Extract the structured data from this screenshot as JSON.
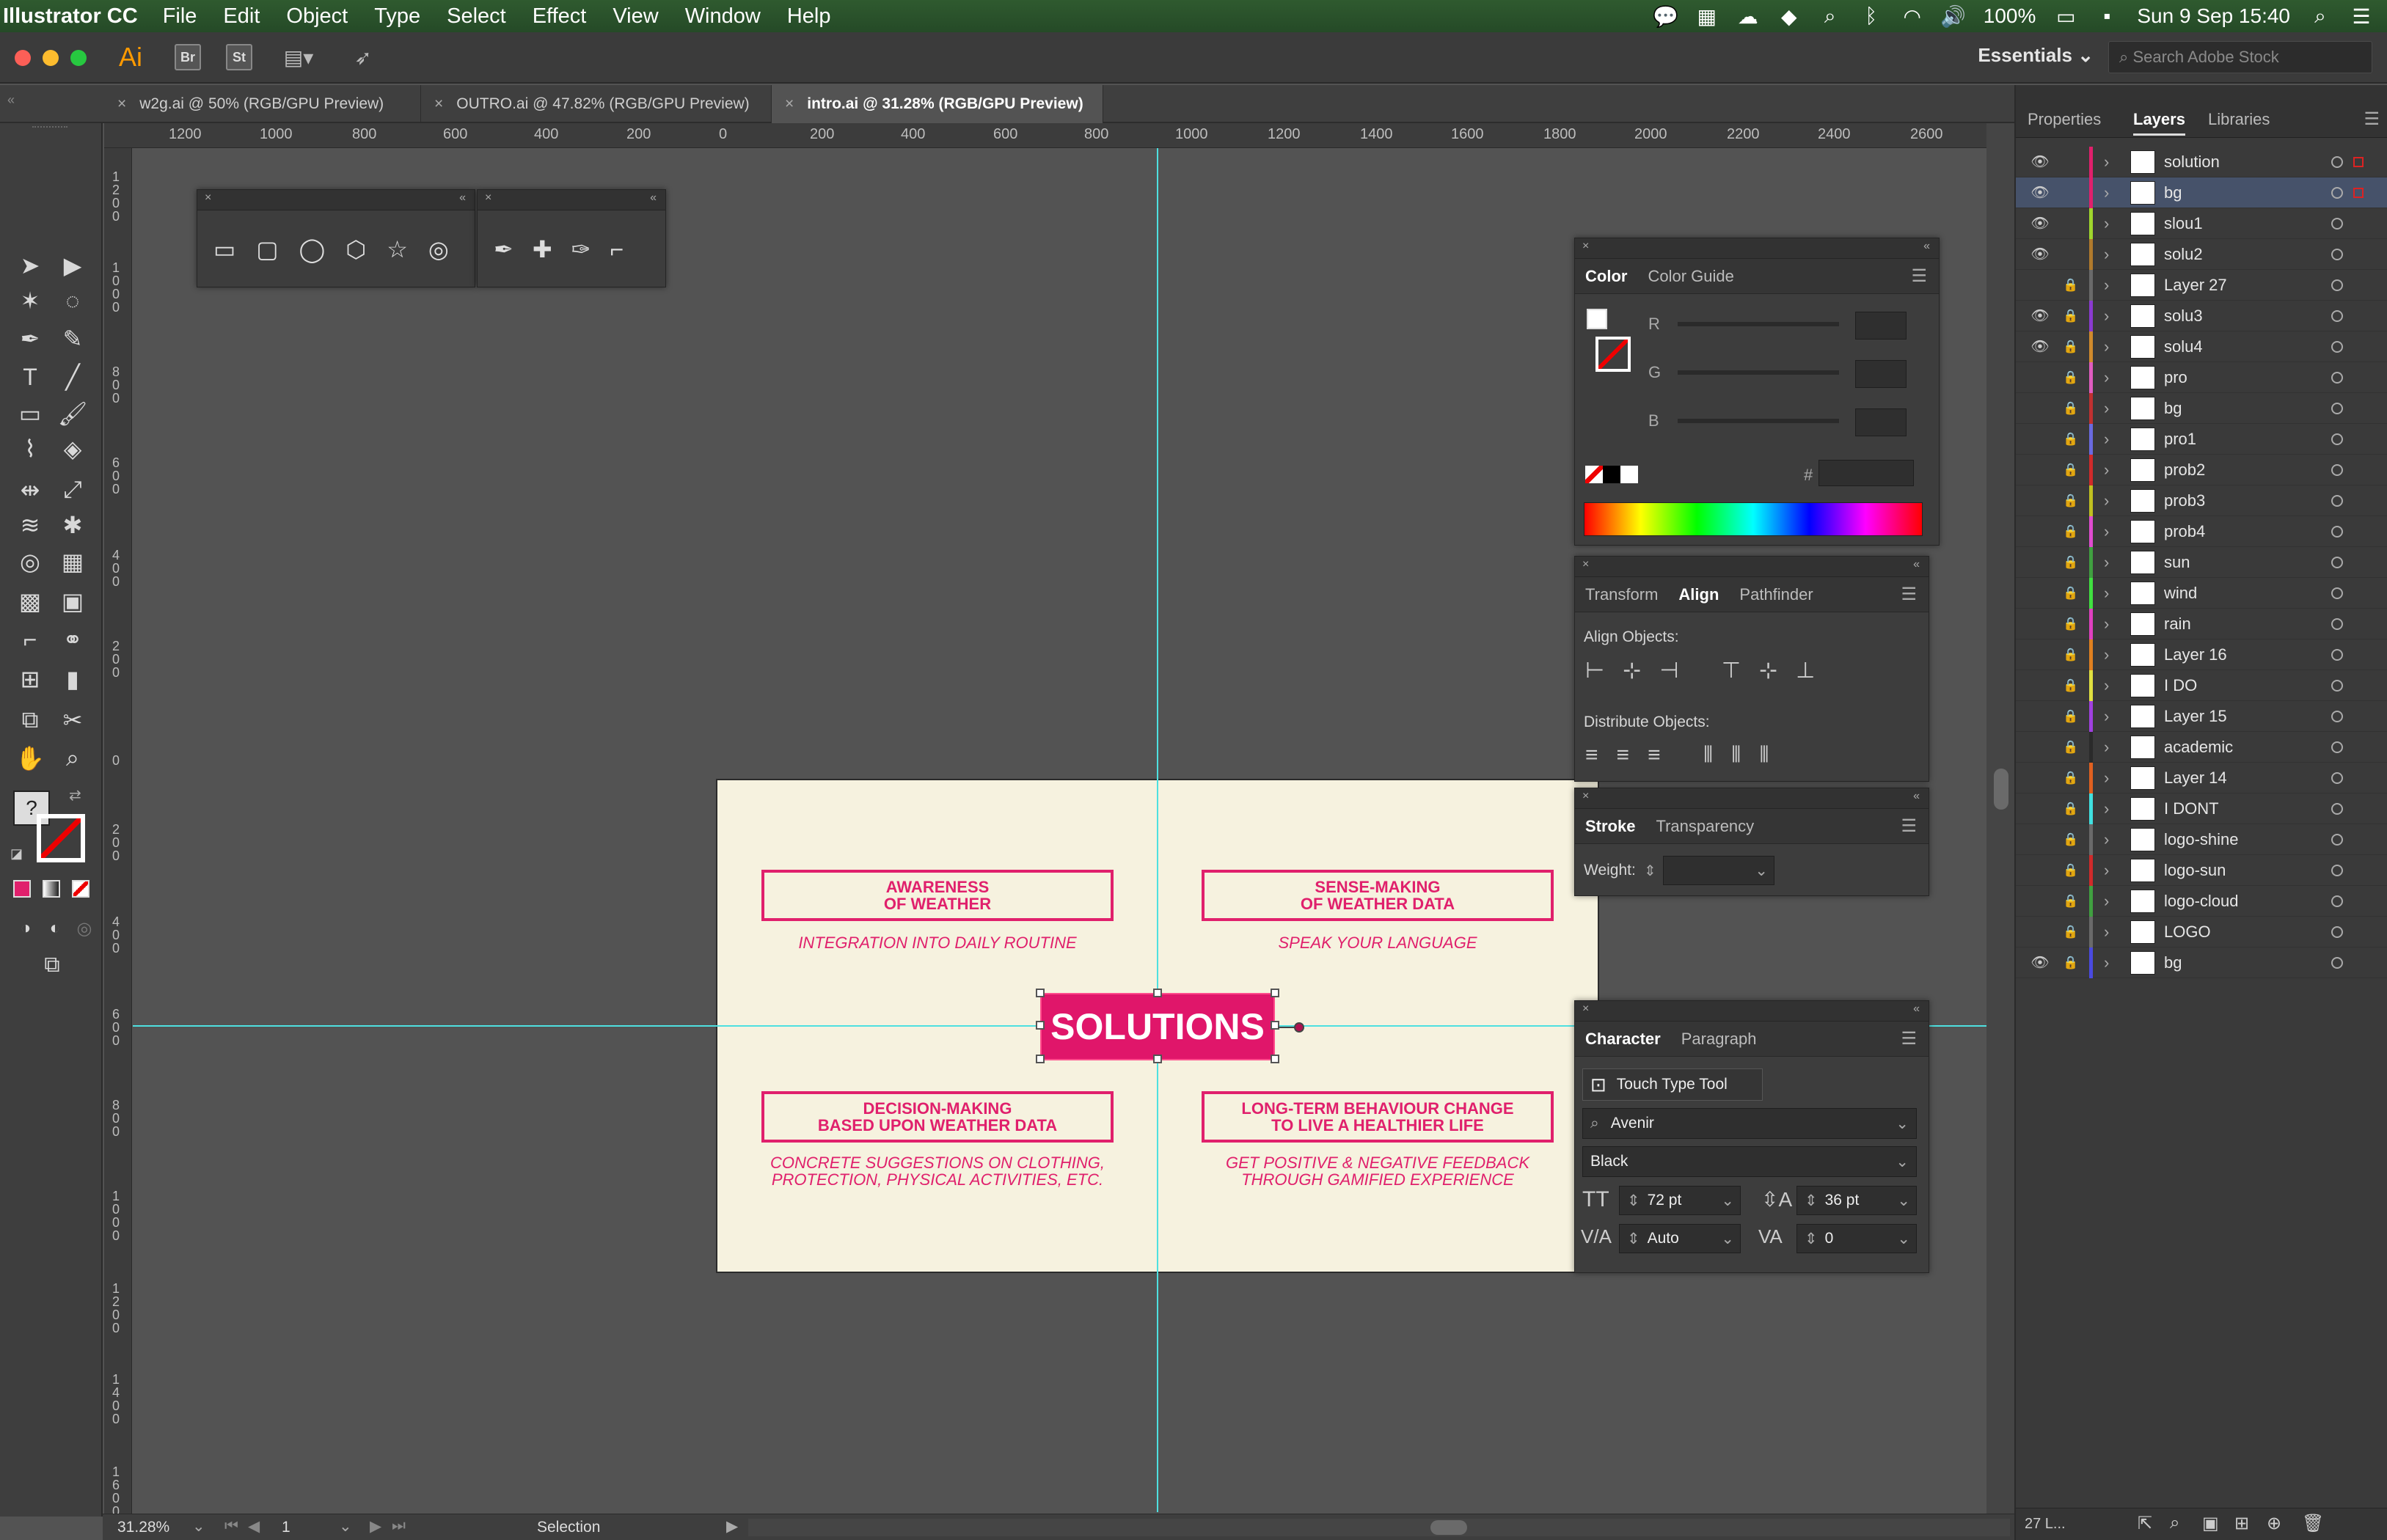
{
  "menubar": {
    "app_name": "Illustrator CC",
    "menus": [
      "File",
      "Edit",
      "Object",
      "Type",
      "Select",
      "Effect",
      "View",
      "Window",
      "Help"
    ],
    "battery": "100%",
    "datetime": "Sun 9 Sep  15:40"
  },
  "appbar": {
    "logo": "Ai",
    "bridge": "Br",
    "stock": "St",
    "workspace": "Essentials",
    "search_placeholder": "Search Adobe Stock"
  },
  "tabs": [
    {
      "label": "w2g.ai @ 50% (RGB/GPU Preview)",
      "active": false
    },
    {
      "label": "OUTRO.ai @ 47.82% (RGB/GPU Preview)",
      "active": false
    },
    {
      "label": "intro.ai @ 31.28% (RGB/GPU Preview)",
      "active": true
    }
  ],
  "ruler": {
    "h_labels": [
      "1200",
      "1000",
      "800",
      "600",
      "400",
      "200",
      "0",
      "200",
      "400",
      "600",
      "800",
      "1000",
      "1200",
      "1400",
      "1600",
      "1800",
      "2000",
      "2200",
      "2400",
      "2600"
    ],
    "v_labels": [
      "1200",
      "1000",
      "800",
      "600",
      "400",
      "200",
      "0",
      "200",
      "400",
      "600",
      "800",
      "1000",
      "1200",
      "1400",
      "1600"
    ]
  },
  "artboard": {
    "box1": {
      "title": "AWARENESS\nOF WEATHER",
      "sub": "INTEGRATION INTO DAILY ROUTINE"
    },
    "box2": {
      "title": "SENSE-MAKING\nOF WEATHER DATA",
      "sub": "SPEAK YOUR LANGUAGE"
    },
    "box3": {
      "title": "DECISION-MAKING\nBASED UPON WEATHER DATA",
      "sub": "CONCRETE SUGGESTIONS ON CLOTHING,\nPROTECTION, PHYSICAL ACTIVITIES, ETC."
    },
    "box4": {
      "title": "LONG-TERM BEHAVIOUR CHANGE\nTO LIVE A HEALTHIER LIFE",
      "sub": "GET POSITIVE & NEGATIVE FEEDBACK\nTHROUGH GAMIFIED EXPERIENCE"
    },
    "center": "SOLUTIONS",
    "colors": {
      "accent": "#e0206c",
      "background": "#f6f2df"
    }
  },
  "color_panel": {
    "tabs": [
      "Color",
      "Color Guide"
    ],
    "channels": [
      "R",
      "G",
      "B"
    ],
    "hash": "#"
  },
  "align_panel": {
    "tabs": [
      "Transform",
      "Align",
      "Pathfinder"
    ],
    "align_objects": "Align Objects:",
    "distribute_objects": "Distribute Objects:"
  },
  "stroke_panel": {
    "tabs": [
      "Stroke",
      "Transparency"
    ],
    "weight_label": "Weight:"
  },
  "character_panel": {
    "tabs": [
      "Character",
      "Paragraph"
    ],
    "touch_type": "Touch Type Tool",
    "font_family": "Avenir",
    "font_style": "Black",
    "font_size": "72 pt",
    "leading": "36 pt",
    "kerning": "Auto",
    "tracking": "0"
  },
  "right_panel": {
    "tabs": [
      "Properties",
      "Layers",
      "Libraries"
    ],
    "layers": [
      {
        "name": "solution",
        "visible": true,
        "locked": false,
        "color": "#e0206c"
      },
      {
        "name": "bg",
        "visible": true,
        "locked": false,
        "color": "#e0206c",
        "selected": true
      },
      {
        "name": "slou1",
        "visible": true,
        "locked": false,
        "color": "#9fd62c"
      },
      {
        "name": "solu2",
        "visible": true,
        "locked": false,
        "color": "#b07a2c"
      },
      {
        "name": "Layer 27",
        "visible": false,
        "locked": true,
        "color": "#6a6a6a"
      },
      {
        "name": "solu3",
        "visible": true,
        "locked": true,
        "color": "#8a3ad0"
      },
      {
        "name": "solu4",
        "visible": true,
        "locked": true,
        "color": "#d08a2c"
      },
      {
        "name": "pro",
        "visible": false,
        "locked": true,
        "color": "#e05cc0"
      },
      {
        "name": "bg",
        "visible": false,
        "locked": true,
        "color": "#c03030"
      },
      {
        "name": "pro1",
        "visible": false,
        "locked": true,
        "color": "#6a6ae0"
      },
      {
        "name": "prob2",
        "visible": false,
        "locked": true,
        "color": "#d02a2a"
      },
      {
        "name": "prob3",
        "visible": false,
        "locked": true,
        "color": "#c0c020"
      },
      {
        "name": "prob4",
        "visible": false,
        "locked": true,
        "color": "#e04cd0"
      },
      {
        "name": "sun",
        "visible": false,
        "locked": true,
        "color": "#40a040"
      },
      {
        "name": "wind",
        "visible": false,
        "locked": true,
        "color": "#40e040"
      },
      {
        "name": "rain",
        "visible": false,
        "locked": true,
        "color": "#e040c0"
      },
      {
        "name": "Layer 16",
        "visible": false,
        "locked": true,
        "color": "#e08020"
      },
      {
        "name": "I DO",
        "visible": false,
        "locked": true,
        "color": "#e0e040"
      },
      {
        "name": "Layer 15",
        "visible": false,
        "locked": true,
        "color": "#a040e0"
      },
      {
        "name": "academic",
        "visible": false,
        "locked": true,
        "color": "#2a2a2a"
      },
      {
        "name": "Layer 14",
        "visible": false,
        "locked": true,
        "color": "#e06020"
      },
      {
        "name": "I DONT",
        "visible": false,
        "locked": true,
        "color": "#40e0e0"
      },
      {
        "name": "logo-shine",
        "visible": false,
        "locked": true,
        "color": "#6a6a6a"
      },
      {
        "name": "logo-sun",
        "visible": false,
        "locked": true,
        "color": "#d02a2a"
      },
      {
        "name": "logo-cloud",
        "visible": false,
        "locked": true,
        "color": "#40a040"
      },
      {
        "name": "LOGO",
        "visible": false,
        "locked": true,
        "color": "#6a6a6a"
      },
      {
        "name": "bg",
        "visible": true,
        "locked": true,
        "color": "#4a4ae0"
      }
    ],
    "layer_count": "27 L..."
  },
  "status": {
    "zoom": "31.28%",
    "page": "1",
    "tool": "Selection"
  }
}
